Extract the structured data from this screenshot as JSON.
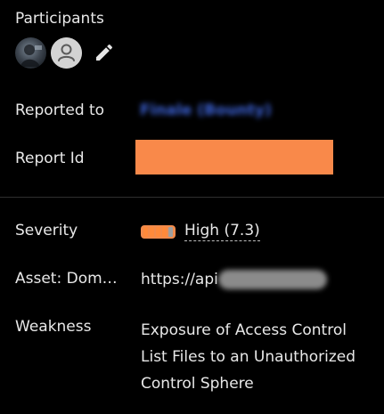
{
  "participants": {
    "label": "Participants",
    "avatars": [
      {
        "icon": "user-photo-avatar"
      },
      {
        "icon": "default-user-avatar"
      }
    ],
    "edit_icon": "pencil-icon"
  },
  "reported_to": {
    "label": "Reported to",
    "value": "Finale (Bounty)"
  },
  "report_id": {
    "label": "Report Id",
    "redaction_color": "#f9894a"
  },
  "severity": {
    "label": "Severity",
    "value": "High (7.3)",
    "meter_level": 4,
    "meter_total": 5,
    "color": "#ff8a3a"
  },
  "asset": {
    "label": "Asset: Dom…",
    "value_prefix": "https://api"
  },
  "weakness": {
    "label": "Weakness",
    "value": "Exposure of Access Control List Files to an Unauthorized Control Sphere"
  }
}
